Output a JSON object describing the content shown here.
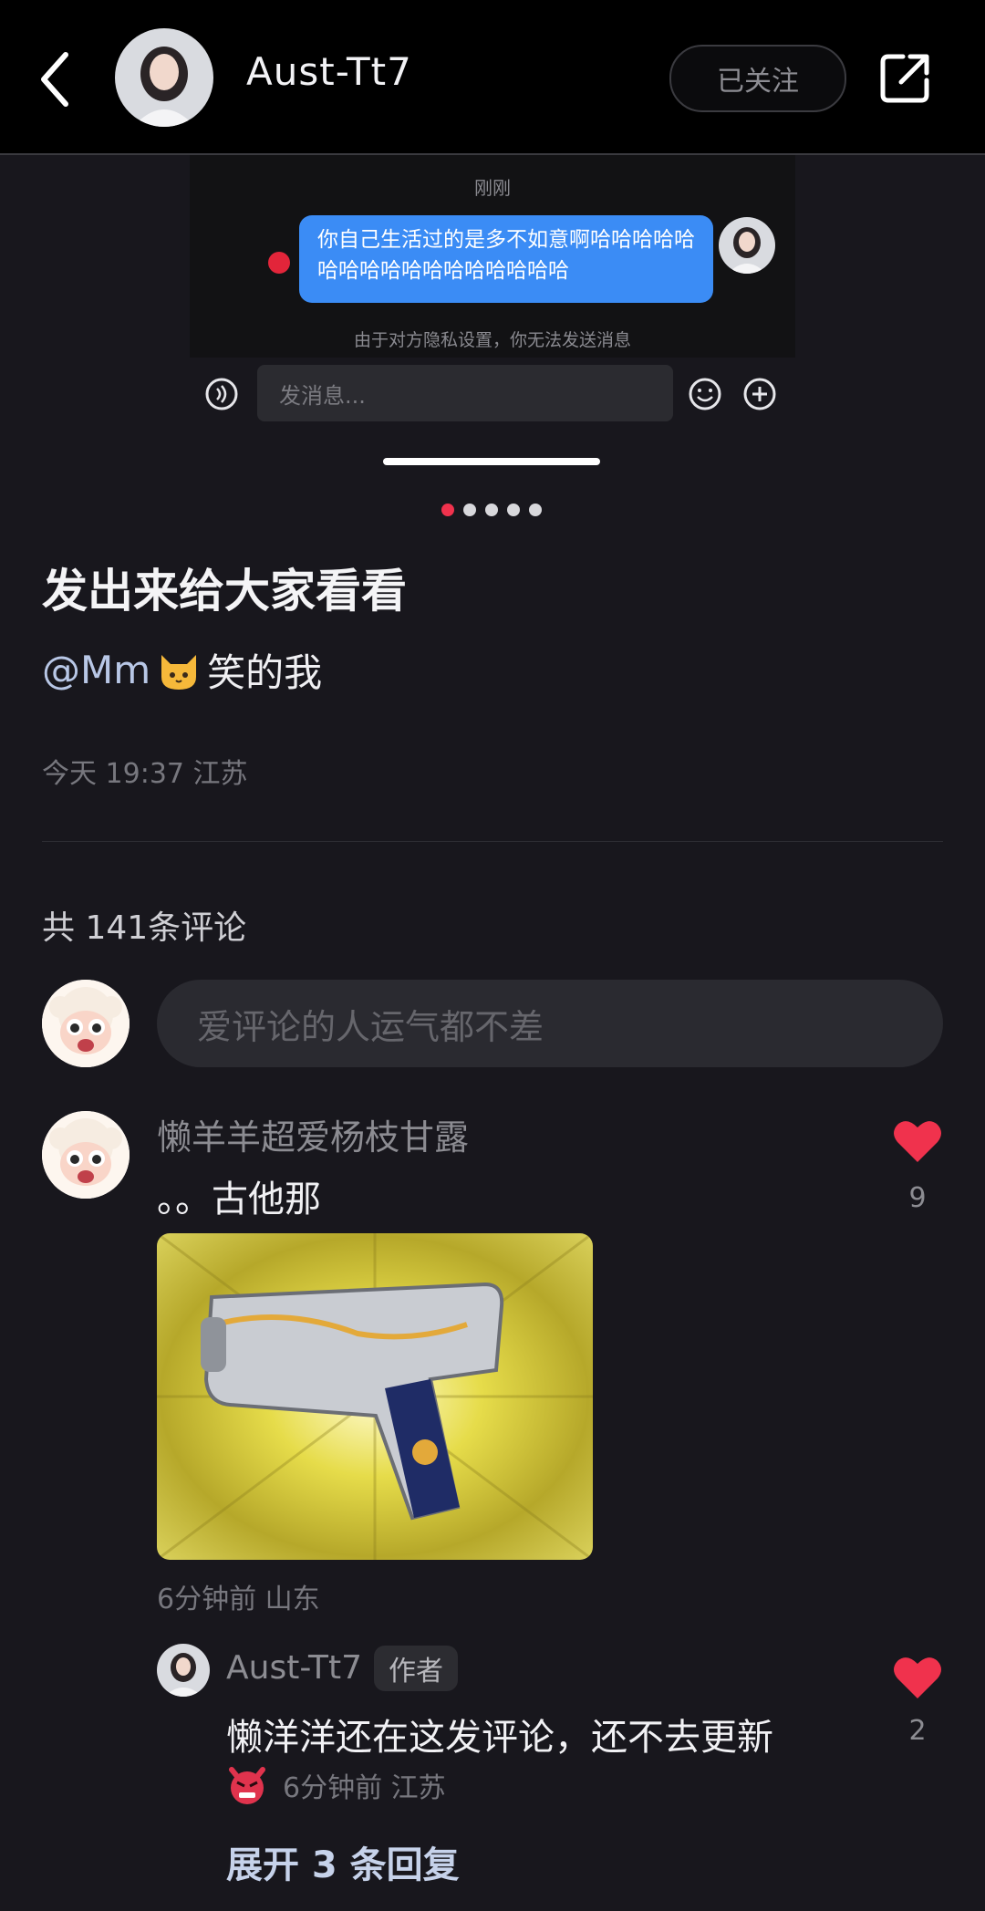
{
  "header": {
    "username": "Aust-Tt7",
    "follow_label": "已关注"
  },
  "screenshot": {
    "time": "刚刚",
    "bubble_text": "你自己生活过的是多不如意啊哈哈哈哈哈哈哈哈哈哈哈哈哈哈哈哈哈",
    "privacy_note": "由于对方隐私设置，你无法发送消息",
    "input_placeholder": "发消息..."
  },
  "carousel": {
    "total": 5,
    "active": 1
  },
  "post": {
    "title": "发出来给大家看看",
    "mention": "@Mm",
    "body_suffix": " 笑的我",
    "meta": "今天 19:37 江苏"
  },
  "comments_section": {
    "count_label": "共 141条评论",
    "input_placeholder": "爱评论的人运气都不差"
  },
  "comment": {
    "author": "懒羊羊超爱杨枝甘露",
    "text": "。。古他那",
    "meta": "6分钟前  山东",
    "likes": "9"
  },
  "reply": {
    "author": "Aust-Tt7",
    "badge": "作者",
    "text": "懒洋洋还在这发评论，还不去更新",
    "meta": "6分钟前  江苏",
    "likes": "2",
    "expand_label": "展开 3 条回复"
  },
  "colors": {
    "accent": "#f0324d",
    "bubble": "#3b8cf5",
    "background": "#18171d"
  }
}
